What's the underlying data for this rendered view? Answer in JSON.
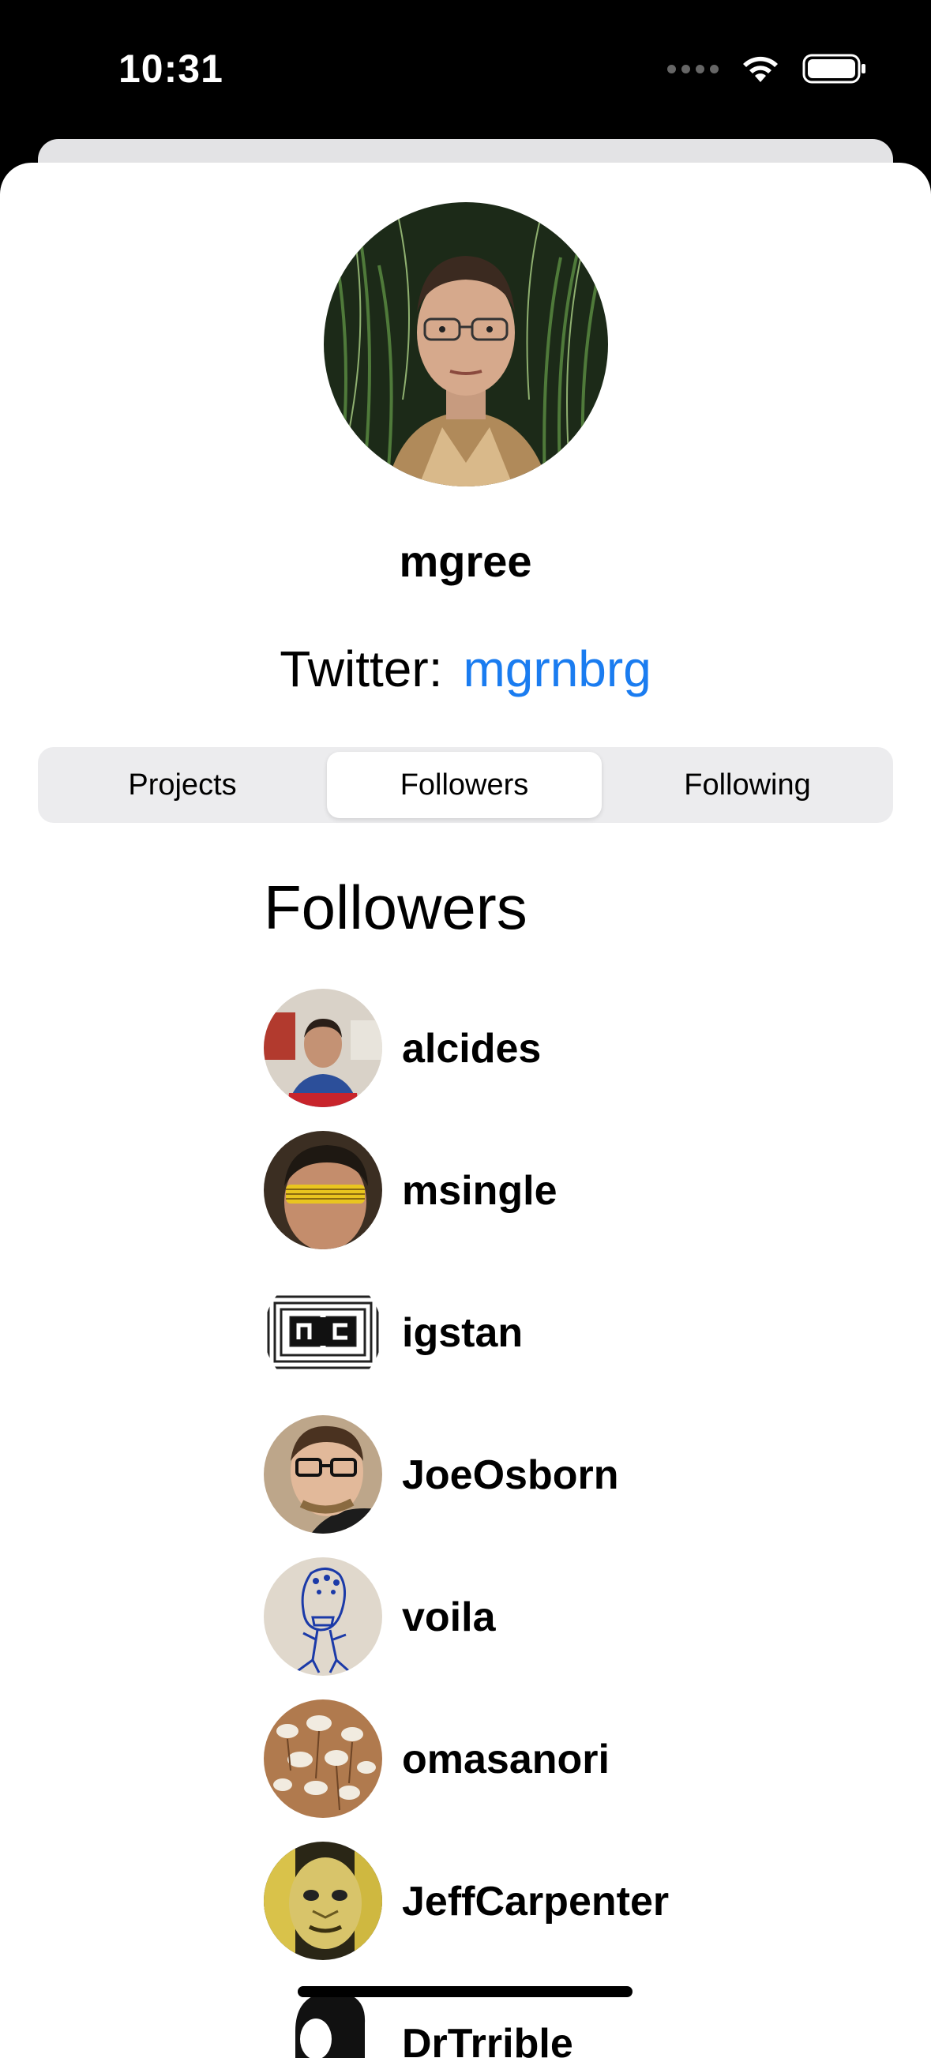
{
  "status": {
    "time": "10:31"
  },
  "profile": {
    "username": "mgree",
    "twitter_label": "Twitter:",
    "twitter_handle": "mgrnbrg"
  },
  "tabs": [
    {
      "label": "Projects",
      "selected": false
    },
    {
      "label": "Followers",
      "selected": true
    },
    {
      "label": "Following",
      "selected": false
    }
  ],
  "section_title": "Followers",
  "followers": [
    {
      "name": "alcides"
    },
    {
      "name": "msingle"
    },
    {
      "name": "igstan"
    },
    {
      "name": "JoeOsborn"
    },
    {
      "name": "voila"
    },
    {
      "name": "omasanori"
    },
    {
      "name": "JeffCarpenter"
    },
    {
      "name": "DrTrrible"
    }
  ],
  "colors": {
    "link": "#1a7cf0",
    "segment_bg": "#ececee"
  }
}
